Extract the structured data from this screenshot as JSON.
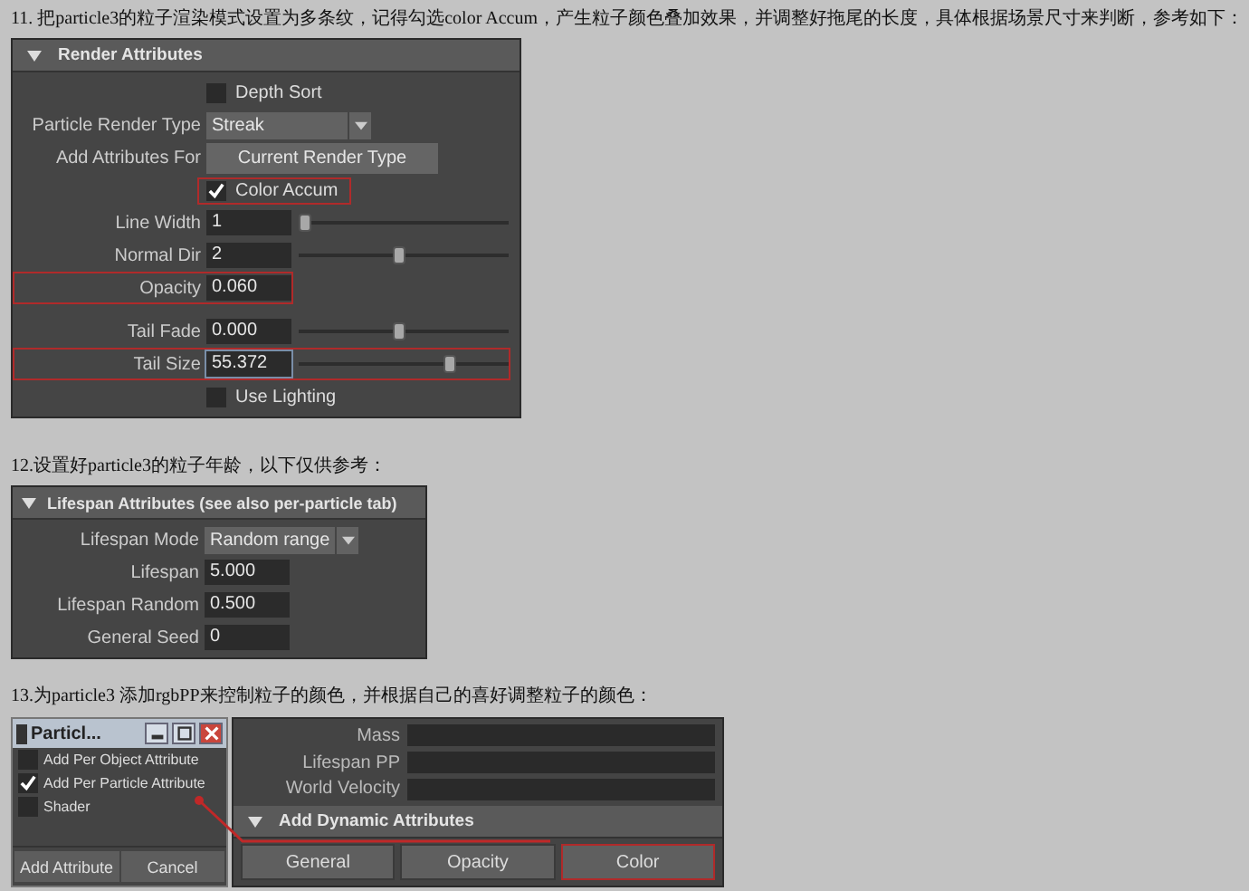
{
  "step11": {
    "text": "11. 把particle3的粒子渲染模式设置为多条纹，记得勾选color Accum，产生粒子颜色叠加效果，并调整好拖尾的长度，具体根据场景尺寸来判断，参考如下："
  },
  "render_panel": {
    "title": "Render Attributes",
    "expanded": true,
    "rows": [
      {
        "kind": "checkbox",
        "label": "Depth Sort",
        "checked": false,
        "highlighted": false
      },
      {
        "kind": "dropdown",
        "label": "Particle Render Type",
        "value": "Streak",
        "highlighted": false
      },
      {
        "kind": "button",
        "label": "Add Attributes For",
        "value": "Current Render Type",
        "highlighted": false
      },
      {
        "kind": "checkbox",
        "label": "Color Accum",
        "checked": true,
        "highlighted": true
      },
      {
        "kind": "slider",
        "label": "Line Width",
        "value": "1",
        "level": 0.0,
        "highlighted": false
      },
      {
        "kind": "slider",
        "label": "Normal Dir",
        "value": "2",
        "level": 0.48,
        "highlighted": false
      },
      {
        "kind": "field",
        "label": "Opacity",
        "value": "0.060",
        "highlighted": true
      },
      {
        "kind": "slider",
        "label": "Tail Fade",
        "value": "0.000",
        "level": 0.48,
        "highlighted": false
      },
      {
        "kind": "slider",
        "label": "Tail Size",
        "value": "55.372",
        "level": 0.74,
        "highlighted": true
      },
      {
        "kind": "checkbox",
        "label": "Use Lighting",
        "checked": false,
        "highlighted": false
      }
    ]
  },
  "step12": {
    "text": "12.设置好particle3的粒子年龄，以下仅供参考："
  },
  "lifespan_panel": {
    "title": "Lifespan Attributes (see also per-particle tab)",
    "expanded": true,
    "rows": [
      {
        "kind": "dropdown",
        "label": "Lifespan Mode",
        "value": "Random range"
      },
      {
        "kind": "field",
        "label": "Lifespan",
        "value": "5.000"
      },
      {
        "kind": "field",
        "label": "Lifespan Random",
        "value": "0.500"
      },
      {
        "kind": "field",
        "label": "General Seed",
        "value": "0"
      }
    ]
  },
  "step13": {
    "text": "13.为particle3 添加rgbPP来控制粒子的颜色，并根据自己的喜好调整粒子的颜色："
  },
  "dialog": {
    "title": "Particl...",
    "options": [
      {
        "label": "Add Per Object Attribute",
        "checked": false
      },
      {
        "label": "Add Per Particle Attribute",
        "checked": true
      },
      {
        "label": "Shader",
        "checked": false
      }
    ],
    "buttons": [
      "Add Attribute",
      "Cancel"
    ]
  },
  "attributes": [
    "Mass",
    "Lifespan PP",
    "World Velocity"
  ],
  "dynamic_panel": {
    "title": "Add Dynamic Attributes",
    "expanded": true,
    "buttons": [
      {
        "label": "General",
        "highlighted": false
      },
      {
        "label": "Opacity",
        "highlighted": false
      },
      {
        "label": "Color",
        "highlighted": true
      }
    ]
  }
}
